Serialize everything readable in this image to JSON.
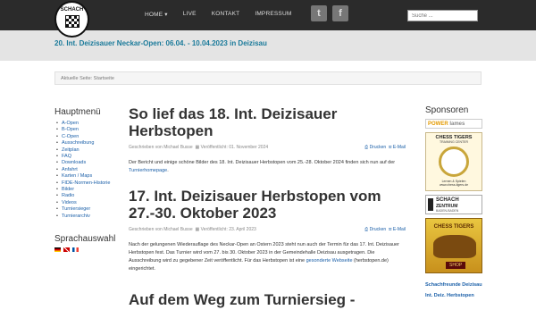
{
  "logo": {
    "text": "SCHACH"
  },
  "nav": {
    "items": [
      "HOME ▾",
      "LIVE",
      "KONTAKT",
      "IMPRESSUM"
    ]
  },
  "search": {
    "placeholder": "Suche ..."
  },
  "banner": {
    "title": "20. Int. Deizisauer Neckar-Open: 06.04. - 10.04.2023 in Deizisau"
  },
  "breadcrumb": {
    "text": "Aktuelle Seite: Startseite"
  },
  "left": {
    "menu_title": "Hauptmenü",
    "menu_items": [
      "A-Open",
      "B-Open",
      "C-Open",
      "Ausschreibung",
      "Zeitplan",
      "FAQ",
      "Downloads",
      "Anfahrt",
      "Karten / Maps",
      "FIDE-Normen-Historie",
      "Bilder",
      "Radio",
      "Videos",
      "Turniersieger",
      "Turnierarchiv"
    ],
    "lang_title": "Sprachauswahl"
  },
  "articles": [
    {
      "title": "So lief das 18. Int. Deizisauer Herbstopen",
      "author": "Geschrieben von Michael Busse",
      "published": "Veröffentlicht: 01. November 2024",
      "print": "Drucken",
      "email": "E-Mail",
      "text": "Der Bericht und einige schöne Bilder des 18. Int. Deizisauer Herbstopen vom 25.-28. Oktober 2024 finden sich nun auf der ",
      "link": "Turnierhomepage",
      "after": "."
    },
    {
      "title": "17. Int. Deizisauer Herbstopen vom 27.-30. Oktober 2023",
      "author": "Geschrieben von Michael Busse",
      "published": "Veröffentlicht: 23. April 2023",
      "print": "Drucken",
      "email": "E-Mail",
      "text": "Nach der gelungenen Wiederauflage des Neckar-Open an Ostern 2023 steht nun auch der Termin für das 17. Int. Deizisauer Herbstopen fest. Das Turnier wird vom 27. bis 30. Oktober 2023 in der Gemeindehalle Deizisau ausgetragen. Die Ausschreibung wird zu gegebener Zeit veröffentlicht. Für das Herbstopen ist eine ",
      "link": "gesonderte Webseite",
      "after": " (herbstopen.de) eingerichtet."
    },
    {
      "title": "Auf dem Weg zum Turniersieg -"
    }
  ],
  "right": {
    "title": "Sponsoren",
    "ads": [
      "POWER",
      "lames",
      "CHESS TIGERS",
      "TRAINING CENTER",
      "Lernen & Spielen",
      "www.chess-tigers.de",
      "SCHACH",
      "ZENTRUM",
      "BADEN-BADEN",
      "CHESS TIGERS",
      "SHOP"
    ],
    "links": [
      "Schachfreunde Deizisau",
      "Int. Deiz. Herbstopen"
    ]
  }
}
